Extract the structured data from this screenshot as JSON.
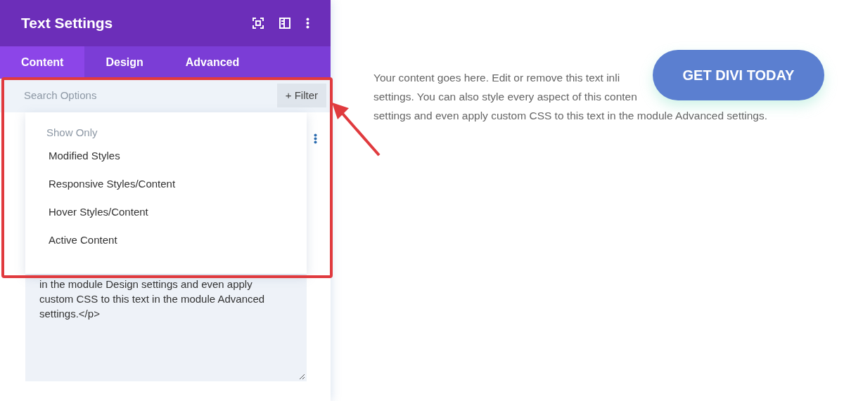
{
  "panel": {
    "title": "Text Settings",
    "tabs": [
      {
        "label": "Content",
        "selected": true
      },
      {
        "label": "Design",
        "selected": false
      },
      {
        "label": "Advanced",
        "selected": false
      }
    ],
    "search": {
      "placeholder": "Search Options"
    },
    "filter_button": "+ Filter",
    "filter_menu": {
      "heading": "Show Only",
      "items": [
        "Modified Styles",
        "Responsive Styles/Content",
        "Hover Styles/Content",
        "Active Content"
      ]
    },
    "editor_lines": [
      "in the module Design settings and even apply",
      "custom CSS to this text in the module Advanced",
      "settings.</p>"
    ]
  },
  "preview": {
    "lines": [
      "Your content goes here. Edit or remove this text inli",
      "settings. You can also style every aspect of this conten",
      "settings and even apply custom CSS to this text in the module Advanced settings."
    ],
    "button": "GET DIVI TODAY"
  }
}
